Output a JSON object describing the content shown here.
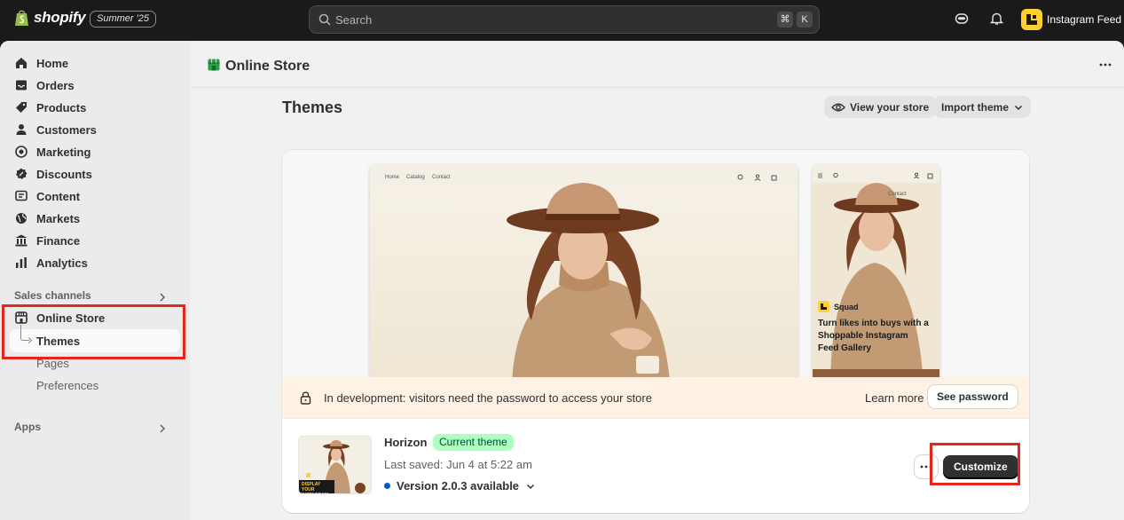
{
  "topbar": {
    "logo_text": "shopify",
    "edition_badge": "Summer '25",
    "search_placeholder": "Search",
    "shortcut_keys": [
      "⌘",
      "K"
    ],
    "store_name": "Instagram Feed"
  },
  "sidebar": {
    "items": [
      {
        "label": "Home",
        "icon": "home-icon"
      },
      {
        "label": "Orders",
        "icon": "inbox-icon"
      },
      {
        "label": "Products",
        "icon": "tag-icon"
      },
      {
        "label": "Customers",
        "icon": "person-icon"
      },
      {
        "label": "Marketing",
        "icon": "target-icon"
      },
      {
        "label": "Discounts",
        "icon": "discount-icon"
      },
      {
        "label": "Content",
        "icon": "content-icon"
      },
      {
        "label": "Markets",
        "icon": "globe-icon"
      },
      {
        "label": "Finance",
        "icon": "bank-icon"
      },
      {
        "label": "Analytics",
        "icon": "chart-icon"
      }
    ],
    "sales_channels_label": "Sales channels",
    "online_store_label": "Online Store",
    "sub_items": [
      "Themes",
      "Pages",
      "Preferences"
    ],
    "apps_label": "Apps"
  },
  "page": {
    "title": "Online Store",
    "heading": "Themes",
    "view_store_label": "View your store",
    "import_theme_label": "Import theme"
  },
  "preview": {
    "desktop_nav": [
      "Home",
      "Catalog",
      "Contact"
    ],
    "mobile_nav": "Contact",
    "mobile_brand": "Squad",
    "mobile_promo": "Turn likes into buys with a Shoppable Instagram Feed Gallery",
    "thumb_caption": "DISPLAY YOUR INSTAGRAM"
  },
  "banner": {
    "text": "In development: visitors need the password to access your store",
    "learn_more": "Learn more",
    "see_password": "See password"
  },
  "theme": {
    "name": "Horizon",
    "badge": "Current theme",
    "last_saved": "Last saved: Jun 4 at 5:22 am",
    "version": "Version 2.0.3 available",
    "customize_label": "Customize"
  },
  "colors": {
    "accent_red": "#e5261d",
    "badge_green": "#affebf",
    "banner_bg": "#fff1e3",
    "version_dot": "#005bd3"
  }
}
